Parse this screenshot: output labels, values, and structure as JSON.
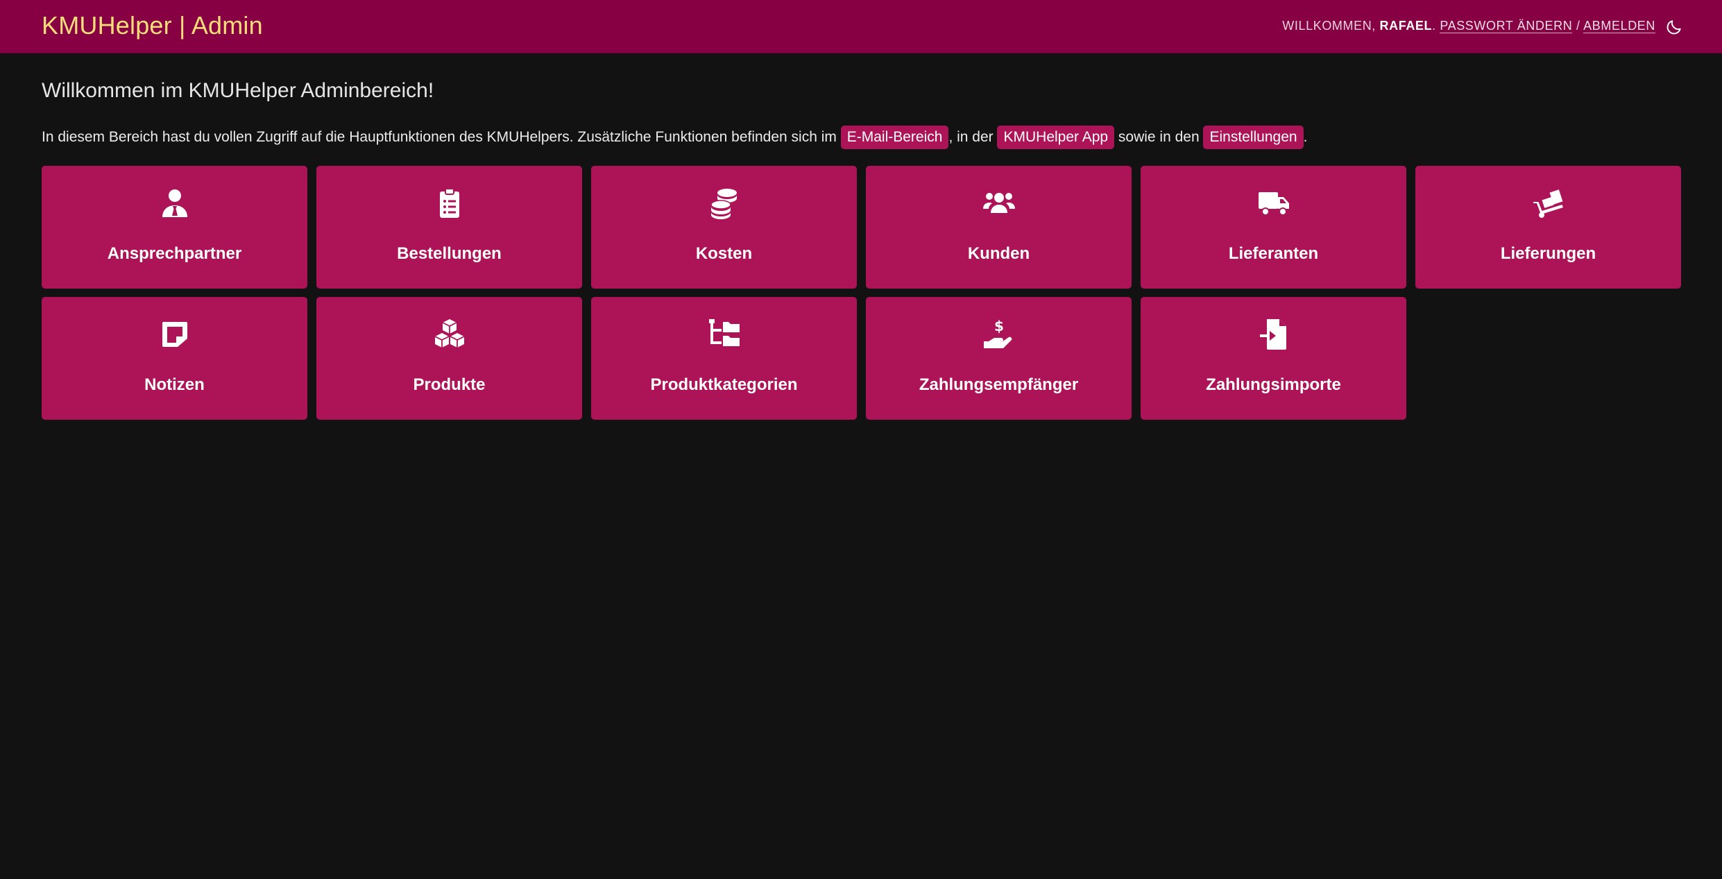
{
  "header": {
    "brand": "KMUHelper | Admin",
    "welcome_prefix": "Willkommen, ",
    "username": "Rafael",
    "separator_dot": ". ",
    "change_password": "Passwort ändern",
    "slash": " / ",
    "logout": "Abmelden",
    "theme_icon": "moon-icon"
  },
  "main": {
    "title": "Willkommen im KMUHelper Adminbereich!",
    "intro_part1": "In diesem Bereich hast du vollen Zugriff auf die Hauptfunktionen des KMUHelpers. Zusätzliche Funktionen befinden sich im ",
    "link_email": "E-Mail-Bereich",
    "intro_part2": ", in der ",
    "link_app": "KMUHelper App",
    "intro_part3": " sowie in den ",
    "link_settings": "Einstellungen",
    "intro_part4": "."
  },
  "tiles": [
    {
      "label": "Ansprechpartner",
      "icon": "user-tie-icon"
    },
    {
      "label": "Bestellungen",
      "icon": "clipboard-list-icon"
    },
    {
      "label": "Kosten",
      "icon": "coins-icon"
    },
    {
      "label": "Kunden",
      "icon": "users-icon"
    },
    {
      "label": "Lieferanten",
      "icon": "truck-icon"
    },
    {
      "label": "Lieferungen",
      "icon": "dolly-icon"
    },
    {
      "label": "Notizen",
      "icon": "sticky-note-icon"
    },
    {
      "label": "Produkte",
      "icon": "cubes-icon"
    },
    {
      "label": "Produktkategorien",
      "icon": "folder-tree-icon"
    },
    {
      "label": "Zahlungsempfänger",
      "icon": "hand-holding-dollar-icon"
    },
    {
      "label": "Zahlungsimporte",
      "icon": "file-import-icon"
    }
  ],
  "colors": {
    "header_bg": "#880044",
    "brand": "#f5dd7a",
    "tile_bg": "#ad1457",
    "page_bg": "#121212"
  }
}
